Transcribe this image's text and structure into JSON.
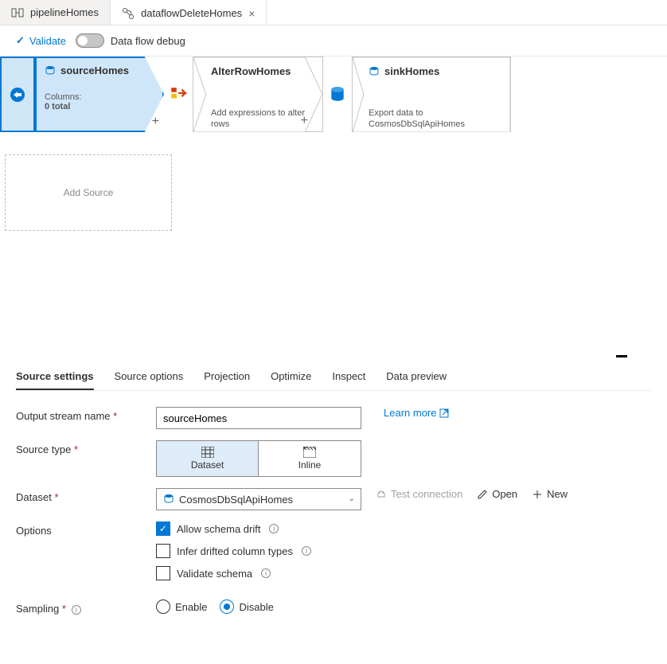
{
  "tabs": [
    {
      "label": "pipelineHomes"
    },
    {
      "label": "dataflowDeleteHomes"
    }
  ],
  "toolbar": {
    "validate": "Validate",
    "debug": "Data flow debug"
  },
  "flow": {
    "source": {
      "title": "sourceHomes",
      "columns_label": "Columns:",
      "columns_count": "0 total"
    },
    "alter": {
      "title": "AlterRowHomes",
      "desc": "Add expressions to alter rows"
    },
    "sink": {
      "title": "sinkHomes",
      "desc": "Export data to CosmosDbSqlApiHomes"
    },
    "add_source": "Add Source"
  },
  "panel": {
    "tabs": {
      "source_settings": "Source settings",
      "source_options": "Source options",
      "projection": "Projection",
      "optimize": "Optimize",
      "inspect": "Inspect",
      "data_preview": "Data preview"
    },
    "output_stream_label": "Output stream name",
    "output_stream_value": "sourceHomes",
    "learn_more": "Learn more",
    "source_type_label": "Source type",
    "source_type_dataset": "Dataset",
    "source_type_inline": "Inline",
    "dataset_label": "Dataset",
    "dataset_value": "CosmosDbSqlApiHomes",
    "ds_actions": {
      "test": "Test connection",
      "open": "Open",
      "new": "New"
    },
    "options_label": "Options",
    "options": {
      "allow_drift": "Allow schema drift",
      "infer_types": "Infer drifted column types",
      "validate_schema": "Validate schema"
    },
    "sampling_label": "Sampling",
    "sampling_enable": "Enable",
    "sampling_disable": "Disable"
  }
}
